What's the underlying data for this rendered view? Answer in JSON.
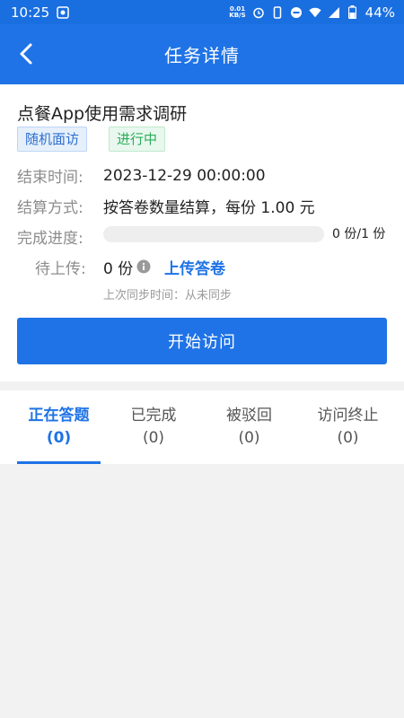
{
  "status_bar": {
    "time": "10:25",
    "net_speed_top": "0.01",
    "net_speed_unit": "KB/S",
    "battery": "44%"
  },
  "nav": {
    "title": "任务详情"
  },
  "task": {
    "title": "点餐App使用需求调研",
    "type_tag": "随机面访",
    "status_tag": "进行中",
    "end_time_label": "结束时间:",
    "end_time": "2023-12-29 00:00:00",
    "settlement_label": "结算方式:",
    "settlement": "按答卷数量结算，每份 1.00 元",
    "progress_label": "完成进度:",
    "progress_text": "0 份/1 份",
    "progress_fraction": 0,
    "upload_label": "待上传:",
    "upload_value": "0 份",
    "upload_link": "上传答卷",
    "sync_text": "上次同步时间：从未同步",
    "start_button": "开始访问"
  },
  "tabs": [
    {
      "label": "正在答题",
      "count": "(0)",
      "active": true
    },
    {
      "label": "已完成",
      "count": "(0)",
      "active": false
    },
    {
      "label": "被驳回",
      "count": "(0)",
      "active": false
    },
    {
      "label": "访问终止",
      "count": "(0)",
      "active": false
    }
  ],
  "colors": {
    "primary": "#1f73e6",
    "status_bar": "#1a6fe0",
    "tag_blue": "#2d6fd1",
    "tag_green": "#2eab5a"
  }
}
